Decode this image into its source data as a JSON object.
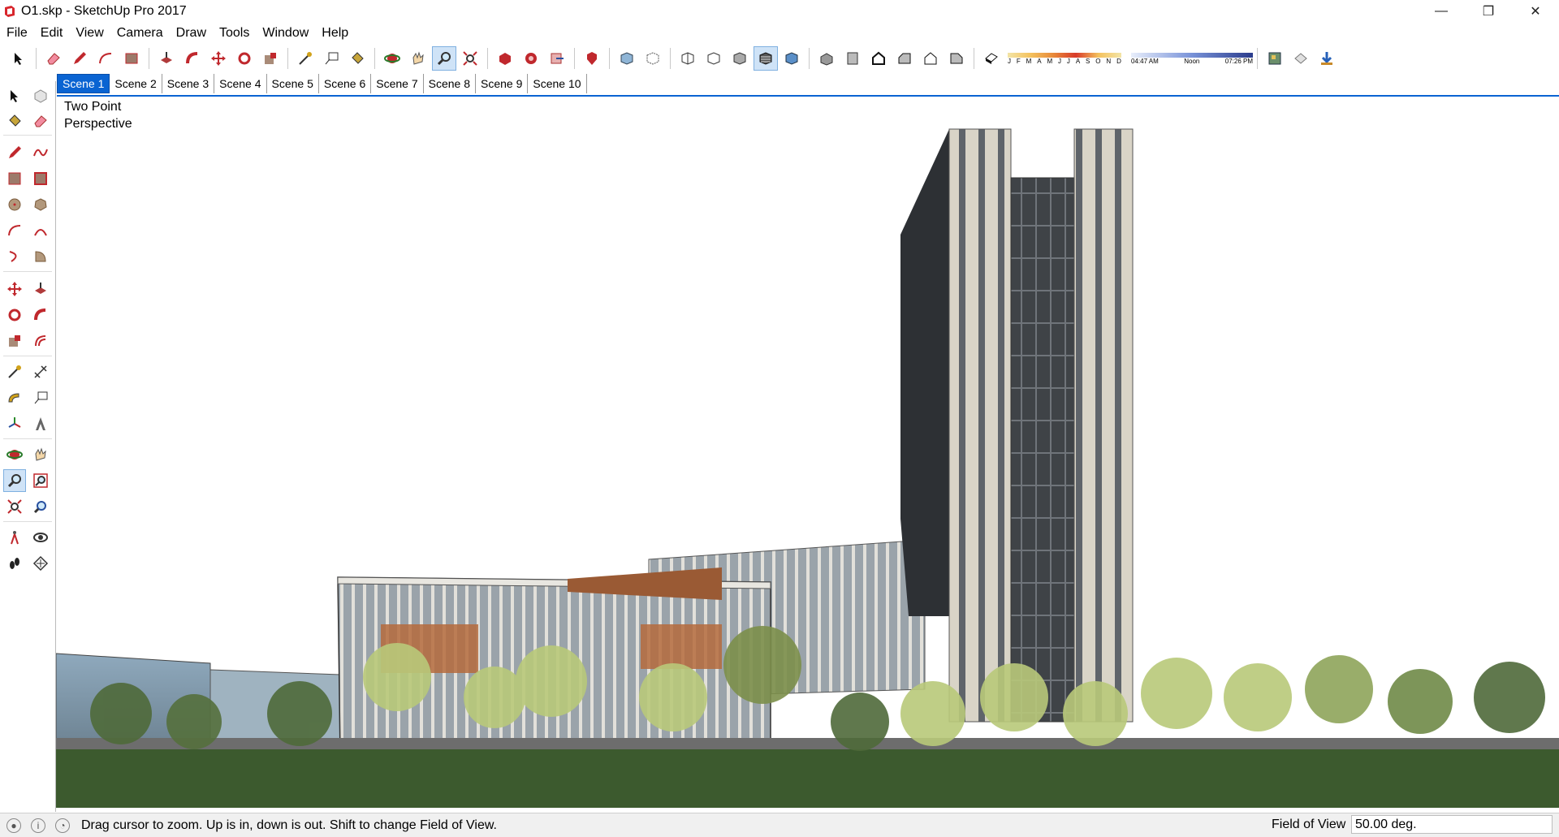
{
  "window": {
    "title": "O1.skp - SketchUp Pro 2017",
    "app_icon": "sketchup-logo-icon",
    "controls": [
      "minimize-icon",
      "restore-icon",
      "close-icon"
    ],
    "control_glyphs": {
      "minimize": "—",
      "restore": "❐",
      "close": "✕"
    }
  },
  "menu": [
    "File",
    "Edit",
    "View",
    "Camera",
    "Draw",
    "Tools",
    "Window",
    "Help"
  ],
  "toolbar": {
    "tools": [
      "select-icon",
      "eraser-icon",
      "pencil-icon",
      "arc-icon",
      "rectangle-icon",
      "push-pull-icon",
      "follow-me-icon",
      "move-icon",
      "rotate-icon",
      "scale-icon",
      "tape-measure-icon",
      "text-icon",
      "paint-bucket-icon",
      "orbit-icon",
      "pan-icon",
      "zoom-icon",
      "zoom-extents-icon",
      "3d-warehouse-icon",
      "extension-warehouse-icon",
      "send-to-layout-icon",
      "extension-manager-icon",
      "xray-icon",
      "back-edges-icon",
      "wireframe-icon",
      "hidden-line-icon",
      "shaded-icon",
      "shaded-with-textures-icon",
      "monochrome-icon",
      "iso-view-icon",
      "top-view-icon",
      "front-view-icon",
      "right-view-icon",
      "back-view-icon",
      "left-view-icon",
      "shadows-toggle-icon",
      "components-icon",
      "styles-icon",
      "downloads-icon"
    ],
    "active_tool": "zoom-icon",
    "shadow_months": [
      "J",
      "F",
      "M",
      "A",
      "M",
      "J",
      "J",
      "A",
      "S",
      "O",
      "N",
      "D"
    ],
    "shadow_times": [
      "04:47 AM",
      "Noon",
      "07:26 PM"
    ]
  },
  "scenes": {
    "tabs": [
      "Scene 1",
      "Scene 2",
      "Scene 3",
      "Scene 4",
      "Scene 5",
      "Scene 6",
      "Scene 7",
      "Scene 8",
      "Scene 9",
      "Scene 10"
    ],
    "active": "Scene 1"
  },
  "palette": {
    "tools": [
      "select-icon",
      "make-component-icon",
      "paint-bucket-icon",
      "eraser-icon",
      "line-icon",
      "freehand-icon",
      "rectangle-icon",
      "rotated-rectangle-icon",
      "circle-icon",
      "polygon-icon",
      "arc-icon",
      "two-point-arc-icon",
      "three-point-arc-icon",
      "pie-icon",
      "move-icon",
      "push-pull-icon",
      "rotate-icon",
      "follow-me-icon",
      "scale-icon",
      "offset-icon",
      "tape-measure-icon",
      "dimension-icon",
      "protractor-icon",
      "text-icon",
      "axes-icon",
      "3d-text-icon",
      "orbit-icon",
      "pan-icon",
      "zoom-icon",
      "zoom-window-icon",
      "zoom-extents-icon",
      "previous-view-icon",
      "position-camera-icon",
      "look-around-icon",
      "walk-icon",
      "section-plane-icon"
    ],
    "active_tool": "zoom-icon"
  },
  "viewport": {
    "camera_label_line1": "Two Point",
    "camera_label_line2": "Perspective",
    "scene": "architectural-model-render"
  },
  "status": {
    "icons": [
      "geo-location-icon",
      "credits-icon",
      "user-account-icon"
    ],
    "message": "Drag cursor to zoom.  Up is in, down is out. Shift to change Field of View.",
    "measurements_label": "Field of View",
    "measurements_value": "50.00 deg."
  },
  "colors": {
    "accent": "#0a64d2",
    "active_tool_bg": "#cfe3f7",
    "sky": "#ffffff",
    "grass": "#3c5a2e",
    "tower_frame": "#d8d2c4",
    "glass": "#4a4f55",
    "wood": "#b06a3e"
  }
}
